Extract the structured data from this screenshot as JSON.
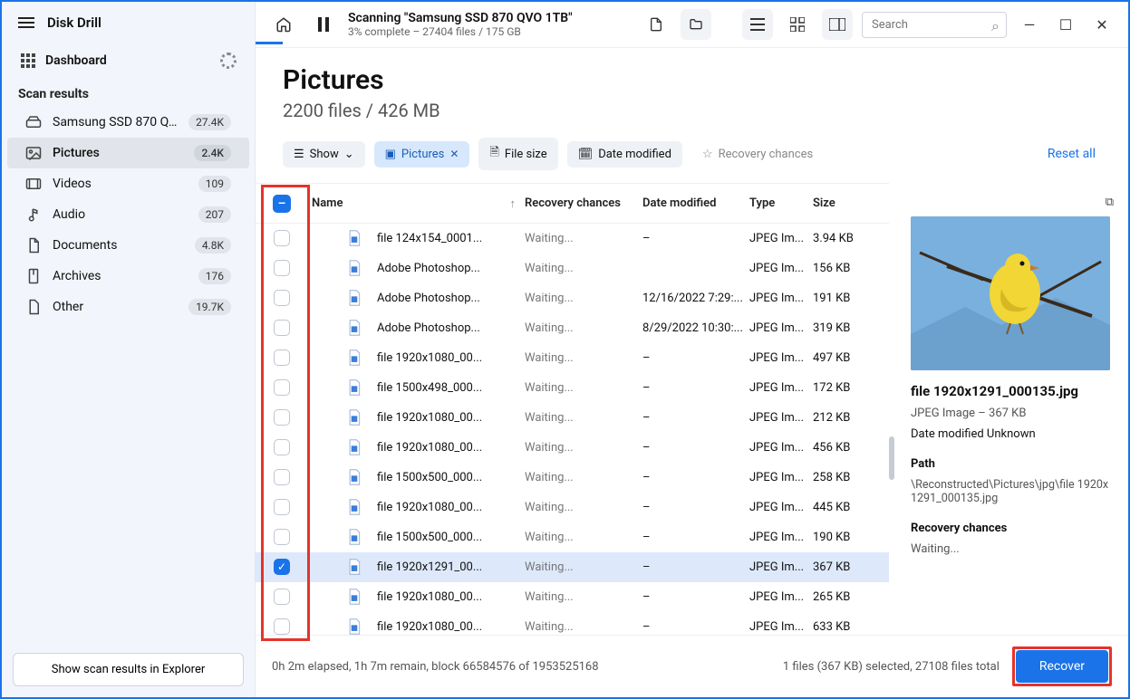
{
  "app": {
    "name": "Disk Drill"
  },
  "sidebar": {
    "dashboard": "Dashboard",
    "scan_results_heading": "Scan results",
    "items": [
      {
        "icon": "hdd-icon",
        "label": "Samsung SSD 870 QV...",
        "count": "27.4K",
        "active": false
      },
      {
        "icon": "picture-icon",
        "label": "Pictures",
        "count": "2.4K",
        "active": true
      },
      {
        "icon": "video-icon",
        "label": "Videos",
        "count": "109",
        "active": false
      },
      {
        "icon": "audio-icon",
        "label": "Audio",
        "count": "207",
        "active": false
      },
      {
        "icon": "document-icon",
        "label": "Documents",
        "count": "4.8K",
        "active": false
      },
      {
        "icon": "archive-icon",
        "label": "Archives",
        "count": "176",
        "active": false
      },
      {
        "icon": "other-icon",
        "label": "Other",
        "count": "19.7K",
        "active": false
      }
    ],
    "footer_button": "Show scan results in Explorer"
  },
  "topbar": {
    "title": "Scanning \"Samsung SSD 870 QVO 1TB\"",
    "subtitle": "3% complete – 27404 files / 175 GB",
    "search_placeholder": "Search"
  },
  "page": {
    "title": "Pictures",
    "subtitle": "2200 files / 426 MB"
  },
  "chips": {
    "show": "Show",
    "pictures": "Pictures",
    "filesize": "File size",
    "datemod": "Date modified",
    "recchance": "Recovery chances",
    "reset": "Reset all"
  },
  "table": {
    "headers": {
      "name": "Name",
      "rc": "Recovery chances",
      "date": "Date modified",
      "type": "Type",
      "size": "Size"
    },
    "rows": [
      {
        "chk": false,
        "name": "file 124x154_0001...",
        "rc": "Waiting...",
        "date": "–",
        "type": "JPEG Im...",
        "size": "3.94 KB"
      },
      {
        "chk": false,
        "name": "Adobe Photoshop...",
        "rc": "Waiting...",
        "date": "",
        "type": "JPEG Im...",
        "size": "156 KB"
      },
      {
        "chk": false,
        "name": "Adobe Photoshop...",
        "rc": "Waiting...",
        "date": "12/16/2022 7:29:...",
        "type": "JPEG Im...",
        "size": "191 KB"
      },
      {
        "chk": false,
        "name": "Adobe Photoshop...",
        "rc": "Waiting...",
        "date": "8/29/2022 10:30:...",
        "type": "JPEG Im...",
        "size": "319 KB"
      },
      {
        "chk": false,
        "name": "file 1920x1080_00...",
        "rc": "Waiting...",
        "date": "–",
        "type": "JPEG Im...",
        "size": "497 KB"
      },
      {
        "chk": false,
        "name": "file 1500x498_000...",
        "rc": "Waiting...",
        "date": "–",
        "type": "JPEG Im...",
        "size": "172 KB"
      },
      {
        "chk": false,
        "name": "file 1920x1080_00...",
        "rc": "Waiting...",
        "date": "–",
        "type": "JPEG Im...",
        "size": "212 KB"
      },
      {
        "chk": false,
        "name": "file 1920x1080_00...",
        "rc": "Waiting...",
        "date": "–",
        "type": "JPEG Im...",
        "size": "456 KB"
      },
      {
        "chk": false,
        "name": "file 1500x500_000...",
        "rc": "Waiting...",
        "date": "–",
        "type": "JPEG Im...",
        "size": "258 KB"
      },
      {
        "chk": false,
        "name": "file 1920x1080_00...",
        "rc": "Waiting...",
        "date": "–",
        "type": "JPEG Im...",
        "size": "445 KB"
      },
      {
        "chk": false,
        "name": "file 1500x500_000...",
        "rc": "Waiting...",
        "date": "–",
        "type": "JPEG Im...",
        "size": "190 KB"
      },
      {
        "chk": true,
        "name": "file 1920x1291_00...",
        "rc": "Waiting...",
        "date": "–",
        "type": "JPEG Im...",
        "size": "367 KB"
      },
      {
        "chk": false,
        "name": "file 1920x1080_00...",
        "rc": "Waiting...",
        "date": "–",
        "type": "JPEG Im...",
        "size": "265 KB"
      },
      {
        "chk": false,
        "name": "file 1920x1080_00...",
        "rc": "Waiting...",
        "date": "–",
        "type": "JPEG Im...",
        "size": "633 KB"
      }
    ]
  },
  "preview": {
    "filename": "file 1920x1291_000135.jpg",
    "meta": "JPEG Image – 367 KB",
    "datemod": "Date modified Unknown",
    "path_label": "Path",
    "path": "\\Reconstructed\\Pictures\\jpg\\file 1920x1291_000135.jpg",
    "rc_label": "Recovery chances",
    "rc_value": "Waiting..."
  },
  "footer": {
    "elapsed": "0h 2m elapsed, 1h 7m remain, block 66584576 of 1953525168",
    "selection": "1 files (367 KB) selected, 27108 files total",
    "recover": "Recover"
  }
}
